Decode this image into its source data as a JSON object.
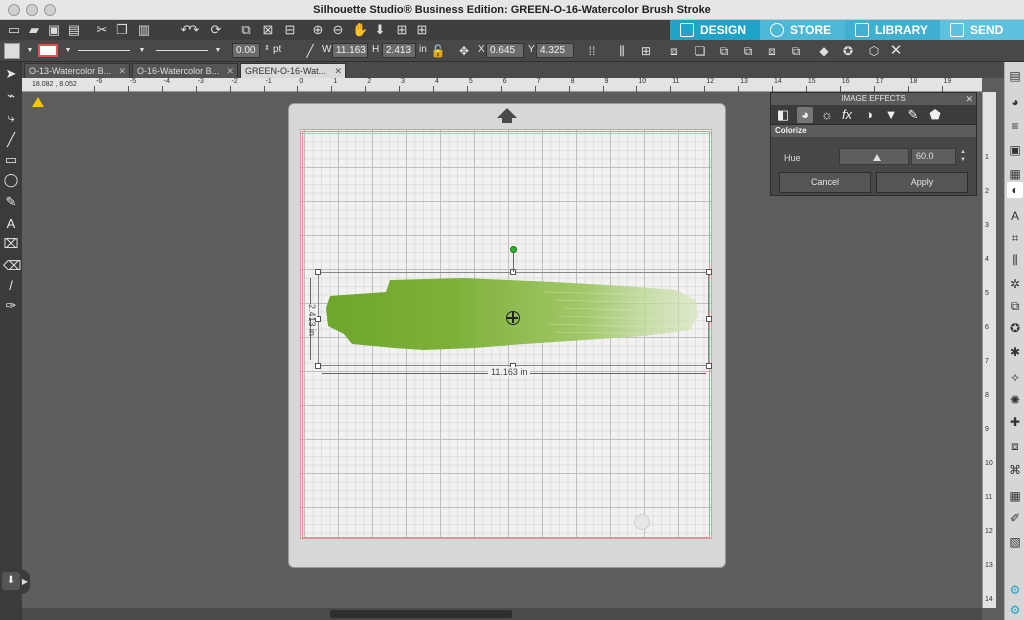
{
  "window": {
    "title": "Silhouette Studio® Business Edition: GREEN-O-16-Watercolor Brush Stroke"
  },
  "nav": {
    "design": "DESIGN",
    "store": "STORE",
    "library": "LIBRARY",
    "send": "SEND"
  },
  "options": {
    "line_width": "0.00",
    "line_unit": "pt",
    "w_label": "W",
    "w_value": "11.163",
    "h_label": "H",
    "h_value": "2.413",
    "size_unit": "in",
    "x_label": "X",
    "x_value": "0.645",
    "y_label": "Y",
    "y_value": "4.325"
  },
  "tabs": [
    {
      "label": "O-13-Watercolor B..."
    },
    {
      "label": "O-16-Watercolor B..."
    },
    {
      "label": "GREEN-O-16-Wat..."
    }
  ],
  "ruler": {
    "h_ticks": [
      "-6",
      "-5",
      "-4",
      "-3",
      "-2",
      "-1",
      "0",
      "1",
      "2",
      "3",
      "4",
      "5",
      "6",
      "7",
      "8",
      "9",
      "10",
      "11",
      "12",
      "13",
      "14",
      "15",
      "16",
      "17",
      "18",
      "19"
    ],
    "v_ticks": [
      "1",
      "2",
      "3",
      "4",
      "5",
      "6",
      "7",
      "8",
      "9",
      "10",
      "11",
      "12",
      "13",
      "14"
    ]
  },
  "cursor_coords": "18.082 , 8.052",
  "canvas": {
    "width_label": "11.163 in",
    "height_label": "2.413 in",
    "brush_color": "#7fae3a"
  },
  "panel": {
    "title": "IMAGE EFFECTS",
    "section": "Colorize",
    "hue_label": "Hue",
    "hue_value": "60.0",
    "cancel": "Cancel",
    "apply": "Apply"
  },
  "colors": {
    "accent": "#1fa3c6",
    "toolbar": "#3e3e3e",
    "panel": "#474747"
  }
}
